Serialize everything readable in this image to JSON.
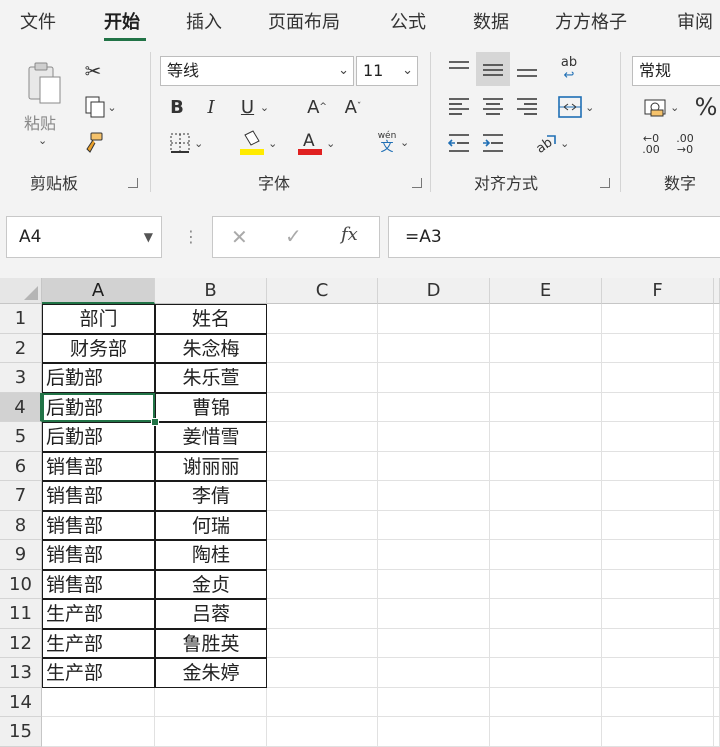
{
  "menu": {
    "tabs": [
      "文件",
      "开始",
      "插入",
      "页面布局",
      "公式",
      "数据",
      "方方格子",
      "审阅"
    ],
    "active": "开始"
  },
  "ribbon": {
    "clipboard": {
      "paste_label": "粘贴",
      "group_label": "剪贴板"
    },
    "font": {
      "font_name": "等线",
      "font_size": "11",
      "phonetic_label": "wén",
      "phonetic_char": "文",
      "group_label": "字体",
      "fill_color": "#ffeb00",
      "font_color": "#e02020"
    },
    "alignment": {
      "group_label": "对齐方式",
      "wrap_label": "ab"
    },
    "number": {
      "format": "常规",
      "percent": "%",
      "group_label": "数字"
    }
  },
  "formula_bar": {
    "name_box": "A4",
    "fx_label": "fx",
    "formula": "=A3"
  },
  "sheet": {
    "columns": [
      "A",
      "B",
      "C",
      "D",
      "E",
      "F"
    ],
    "rows": [
      "1",
      "2",
      "3",
      "4",
      "5",
      "6",
      "7",
      "8",
      "9",
      "10",
      "11",
      "12",
      "13",
      "14",
      "15"
    ],
    "active_cell": "A4",
    "colA": [
      "部门",
      "财务部",
      "后勤部",
      "后勤部",
      "后勤部",
      "销售部",
      "销售部",
      "销售部",
      "销售部",
      "销售部",
      "生产部",
      "生产部",
      "生产部"
    ],
    "colB": [
      "姓名",
      "朱念梅",
      "朱乐萱",
      "曹锦",
      "姜惜雪",
      "谢丽丽",
      "李倩",
      "何瑞",
      "陶桂",
      "金贞",
      "吕蓉",
      "鲁胜英",
      "金朱婷"
    ]
  }
}
